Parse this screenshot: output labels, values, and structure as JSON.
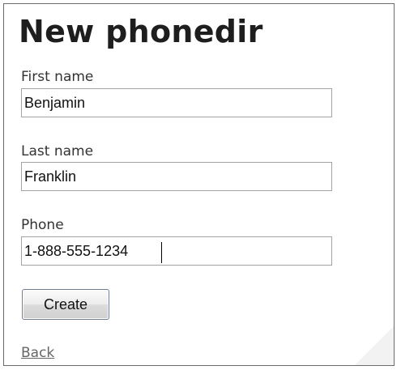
{
  "page": {
    "title": "New phonedir"
  },
  "form": {
    "first_name": {
      "label": "First name",
      "value": "Benjamin"
    },
    "last_name": {
      "label": "Last name",
      "value": "Franklin"
    },
    "phone": {
      "label": "Phone",
      "value": "1-888-555-1234"
    },
    "submit_label": "Create"
  },
  "nav": {
    "back_label": "Back"
  }
}
